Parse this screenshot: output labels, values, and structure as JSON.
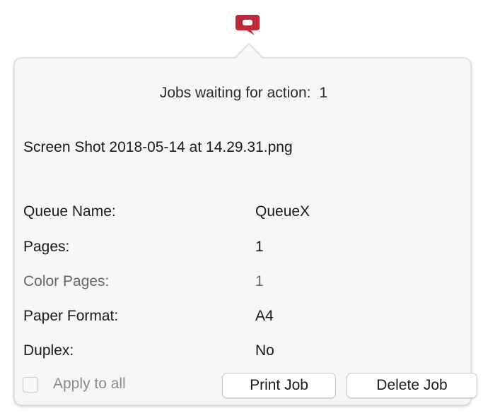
{
  "menubar": {
    "app_icon": "q-logo-icon",
    "accent_color": "#c0283a"
  },
  "popover": {
    "jobs_waiting_label": "Jobs waiting for action:",
    "jobs_waiting_count": "1",
    "file_name": "Screen Shot 2018-05-14 at 14.29.31.png",
    "details": [
      {
        "label": "Queue Name:",
        "value": "QueueX",
        "dim": false
      },
      {
        "label": "Pages:",
        "value": "1",
        "dim": false
      },
      {
        "label": "Color Pages:",
        "value": "1",
        "dim": true
      },
      {
        "label": "Paper Format:",
        "value": "A4",
        "dim": false
      },
      {
        "label": "Duplex:",
        "value": "No",
        "dim": false
      }
    ],
    "apply_to_all_label": "Apply to all",
    "apply_to_all_checked": false,
    "print_button_label": "Print Job",
    "delete_button_label": "Delete Job"
  }
}
